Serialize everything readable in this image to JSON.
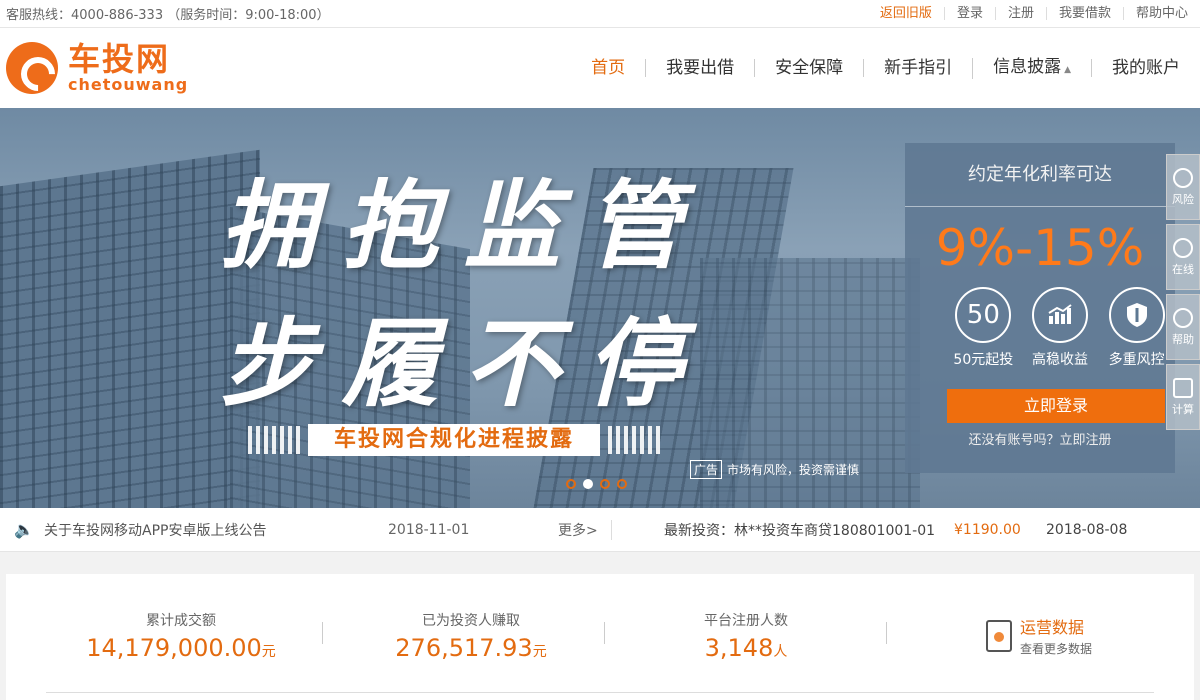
{
  "topbar": {
    "hotline": "客服热线：4000-886-333 （服务时间：9:00-18:00）",
    "links": [
      "返回旧版",
      "登录",
      "注册",
      "我要借款",
      "帮助中心"
    ]
  },
  "logo": {
    "cn": "车投网",
    "en": "chetouwang"
  },
  "nav": {
    "items": [
      "首页",
      "我要出借",
      "安全保障",
      "新手指引",
      "信息披露",
      "我的账户"
    ]
  },
  "banner": {
    "slogan_line1": "拥抱监管",
    "slogan_line2": "步履不停",
    "subtitle": "车投网合规化进程披露",
    "ad_tag": "广告",
    "ad_text": "市场有风险，投资需谨慎",
    "slide_count": 4,
    "active_slide": 2
  },
  "panel": {
    "title": "约定年化利率可达",
    "rate": "9%-15%",
    "features": [
      {
        "icon": "fifty-icon",
        "symbol": "50",
        "label": "50元起投"
      },
      {
        "icon": "chart-icon",
        "symbol": "📈",
        "label": "高稳收益"
      },
      {
        "icon": "shield-icon",
        "symbol": "🛡",
        "label": "多重风控"
      }
    ],
    "login_button": "立即登录",
    "register_text": "还没有账号吗？立即注册"
  },
  "side_tools": [
    "风险",
    "在线",
    "帮助",
    "计算"
  ],
  "notice": {
    "text": "关于车投网移动APP安卓版上线公告",
    "date": "2018-11-01",
    "more": "更多>",
    "latest_investment": "最新投资：林**投资车商贷180801001-01",
    "amount": "¥1190.00",
    "invest_date": "2018-08-08"
  },
  "stats": {
    "items": [
      {
        "label": "累计成交额",
        "value": "14,179,000.00",
        "unit": "元"
      },
      {
        "label": "已为投资人赚取",
        "value": "276,517.93",
        "unit": "元"
      },
      {
        "label": "平台注册人数",
        "value": "3,148",
        "unit": "人"
      }
    ],
    "ops_title": "运营数据",
    "ops_subtitle": "查看更多数据"
  },
  "colors": {
    "accent": "#e36b10",
    "panel_bg": "#5e7892"
  }
}
